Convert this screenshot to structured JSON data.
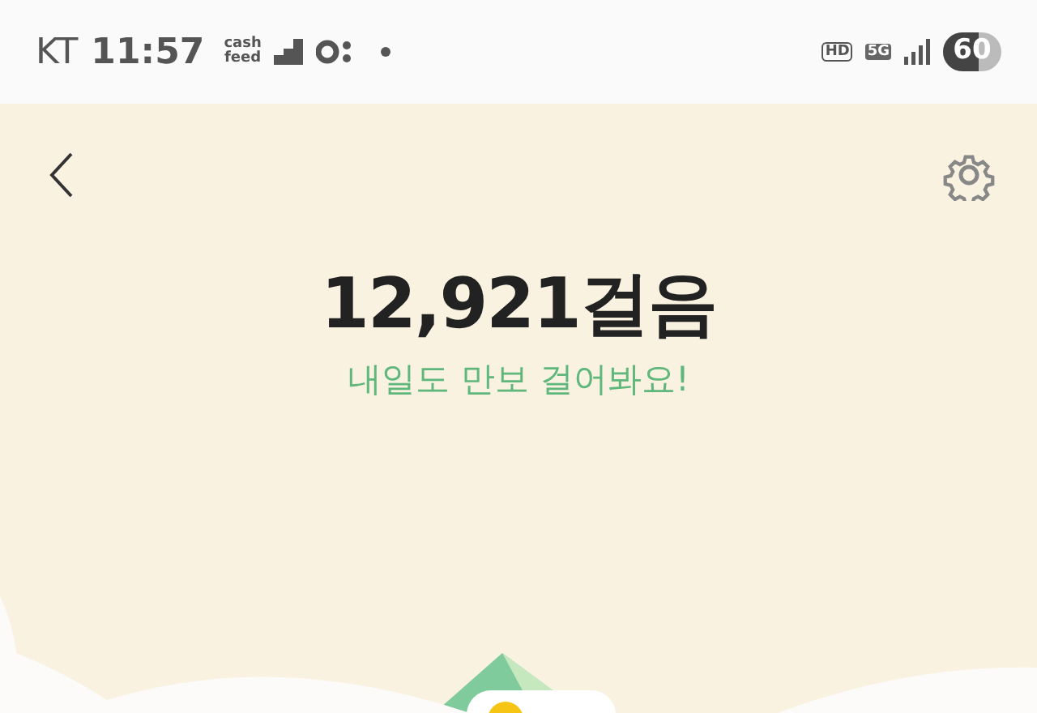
{
  "status_bar": {
    "carrier": "KT",
    "time": "11:57",
    "app_logo": [
      "cash",
      "feed"
    ],
    "hd_badge": "HD",
    "network": "5G",
    "battery": {
      "text": "60",
      "level": 0.6
    }
  },
  "steps": {
    "count": "12,921걸음",
    "message": "내일도 만보 걸어봐요!"
  }
}
